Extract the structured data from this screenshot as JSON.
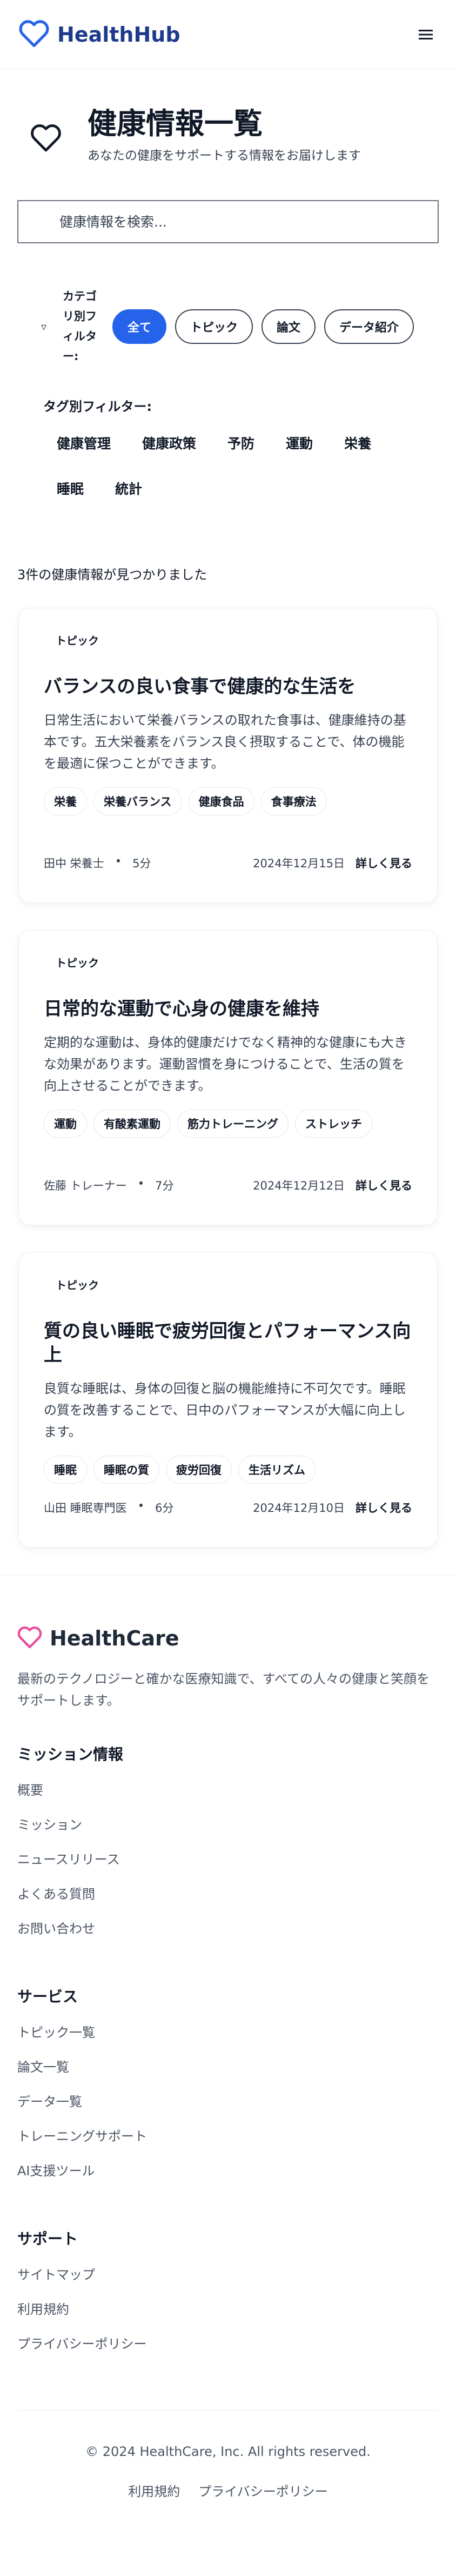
{
  "header": {
    "brand": "HealthHub",
    "brand_color": "#1e3a8a"
  },
  "page": {
    "title": "健康情報一覧",
    "subtitle": "あなたの健康をサポートする情報をお届けします"
  },
  "search": {
    "placeholder": "健康情報を検索..."
  },
  "category_filter": {
    "label": "カテゴリ別フィルター:",
    "options": [
      "全て",
      "トピック",
      "論文",
      "データ紹介"
    ],
    "selected": "全て",
    "active_color": "#2563eb"
  },
  "tag_filter": {
    "label": "タグ別フィルター:",
    "tags": [
      "健康管理",
      "健康政策",
      "予防",
      "運動",
      "栄養",
      "睡眠",
      "統計"
    ]
  },
  "result_count": "3件の健康情報が見つかりました",
  "articles": [
    {
      "category": "トピック",
      "title": "バランスの良い食事で健康的な生活を",
      "excerpt": "日常生活において栄養バランスの取れた食事は、健康維持の基本です。五大栄養素をバランス良く摂取することで、体の機能を最適に保つことができます。",
      "tags": [
        "栄養",
        "栄養バランス",
        "健康食品",
        "食事療法"
      ],
      "author": "田中 栄養士",
      "read_time": "5分",
      "date": "2024年12月15日",
      "read_more": "詳しく見る"
    },
    {
      "category": "トピック",
      "title": "日常的な運動で心身の健康を維持",
      "excerpt": "定期的な運動は、身体的健康だけでなく精神的な健康にも大きな効果があります。運動習慣を身につけることで、生活の質を向上させることができます。",
      "tags": [
        "運動",
        "有酸素運動",
        "筋力トレーニング",
        "ストレッチ"
      ],
      "author": "佐藤 トレーナー",
      "read_time": "7分",
      "date": "2024年12月12日",
      "read_more": "詳しく見る"
    },
    {
      "category": "トピック",
      "title": "質の良い睡眠で疲労回復とパフォーマンス向上",
      "excerpt": "良質な睡眠は、身体の回復と脳の機能維持に不可欠です。睡眠の質を改善することで、日中のパフォーマンスが大幅に向上します。",
      "tags": [
        "睡眠",
        "睡眠の質",
        "疲労回復",
        "生活リズム"
      ],
      "author": "山田 睡眠専門医",
      "read_time": "6分",
      "date": "2024年12月10日",
      "read_more": "詳しく見る"
    }
  ],
  "footer": {
    "brand": "HealthCare",
    "brand_icon_color": "#ec4899",
    "description": "最新のテクノロジーと確かな医療知識で、すべての人々の健康と笑顔をサポートします。",
    "sections": [
      {
        "title": "ミッション情報",
        "links": [
          "概要",
          "ミッション",
          "ニュースリリース",
          "よくある質問",
          "お問い合わせ"
        ]
      },
      {
        "title": "サービス",
        "links": [
          "トピック一覧",
          "論文一覧",
          "データ一覧",
          "トレーニングサポート",
          "AI支援ツール"
        ]
      },
      {
        "title": "サポート",
        "links": [
          "サイトマップ",
          "利用規約",
          "プライバシーポリシー"
        ]
      }
    ],
    "copyright": "© 2024 HealthCare, Inc. All rights reserved.",
    "legal_links": [
      "利用規約",
      "プライバシーポリシー"
    ]
  }
}
